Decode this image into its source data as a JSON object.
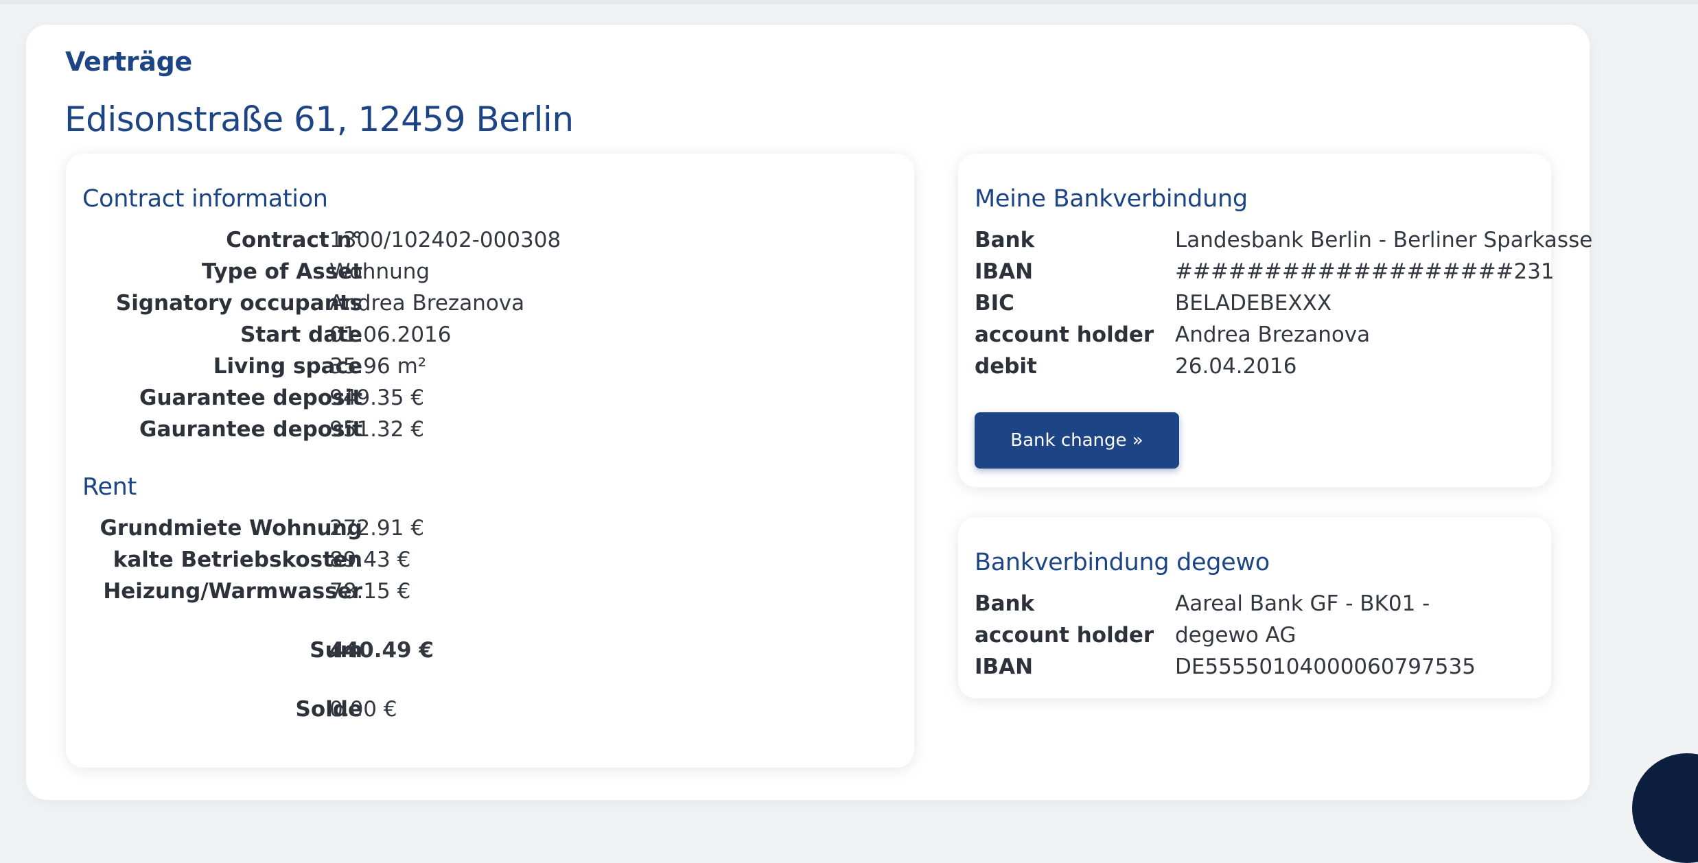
{
  "page": {
    "heading": "Verträge",
    "address": "Edisonstraße 61, 12459 Berlin"
  },
  "contract": {
    "title": "Contract information",
    "rows": [
      {
        "label": "Contract n°",
        "value": "1300/102402-000308"
      },
      {
        "label": "Type of Asset",
        "value": "Wohnung"
      },
      {
        "label": "Signatory occupants",
        "value": "Andrea Brezanova"
      },
      {
        "label": "Start date",
        "value": "01.06.2016"
      },
      {
        "label": "Living space",
        "value": "35.96 m²"
      },
      {
        "label": "Guarantee deposit",
        "value": "949.35 €"
      },
      {
        "label": "Gaurantee deposit",
        "value": "951.32 €"
      }
    ]
  },
  "rent": {
    "title": "Rent",
    "rows": [
      {
        "label": "Grundmiete Wohnung",
        "value": "272.91 €"
      },
      {
        "label": "kalte Betriebskosten",
        "value": "89.43 €"
      },
      {
        "label": "Heizung/Warmwasser",
        "value": "78.15 €"
      }
    ],
    "sum_label": "Sum",
    "sum_value": "440.49 €",
    "solde_label": "Solde",
    "solde_value": "0.00 €"
  },
  "my_bank": {
    "title": "Meine Bankverbindung",
    "rows": [
      {
        "label": "Bank",
        "value": "Landesbank Berlin - Berliner Sparkasse"
      },
      {
        "label": "IBAN",
        "value": "###################231"
      },
      {
        "label": "BIC",
        "value": "BELADEBEXXX"
      },
      {
        "label": "account holder",
        "value": "Andrea Brezanova"
      },
      {
        "label": "debit",
        "value": "26.04.2016"
      }
    ],
    "button_label": "Bank change »"
  },
  "degewo_bank": {
    "title": "Bankverbindung degewo",
    "rows": [
      {
        "label": "Bank",
        "value": "Aareal Bank GF - BK01 -"
      },
      {
        "label": "account holder",
        "value": "degewo AG"
      },
      {
        "label": "IBAN",
        "value": "DE55550104000060797535"
      }
    ]
  }
}
